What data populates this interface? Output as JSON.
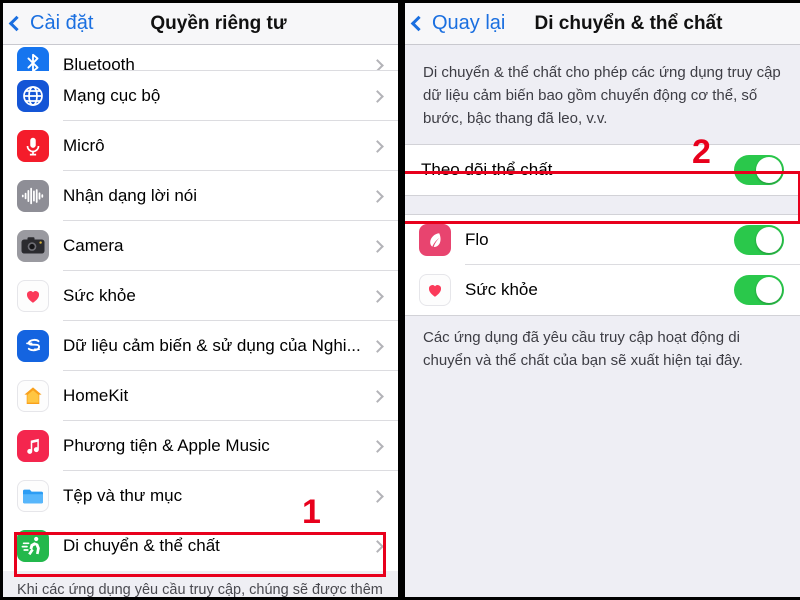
{
  "left": {
    "nav": {
      "back_label": "Cài đặt",
      "title": "Quyền riêng tư"
    },
    "rows": [
      {
        "label": "Bluetooth",
        "icon": "bluetooth-icon"
      },
      {
        "label": "Mạng cục bộ",
        "icon": "local-network-icon"
      },
      {
        "label": "Micrô",
        "icon": "microphone-icon"
      },
      {
        "label": "Nhận dạng lời nói",
        "icon": "speech-recognition-icon"
      },
      {
        "label": "Camera",
        "icon": "camera-icon"
      },
      {
        "label": "Sức khỏe",
        "icon": "health-icon"
      },
      {
        "label": "Dữ liệu cảm biến & sử dụng của Nghi...",
        "icon": "research-sensor-icon"
      },
      {
        "label": "HomeKit",
        "icon": "homekit-icon"
      },
      {
        "label": "Phương tiện & Apple Music",
        "icon": "apple-music-icon"
      },
      {
        "label": "Tệp và thư mục",
        "icon": "files-folder-icon"
      },
      {
        "label": "Di chuyển & thể chất",
        "icon": "motion-fitness-icon"
      }
    ],
    "footer_note": "Khi các ứng dụng yêu cầu truy cập, chúng sẽ được thêm"
  },
  "right": {
    "nav": {
      "back_label": "Quay lại",
      "title": "Di chuyển & thể chất"
    },
    "description": "Di chuyển & thể chất cho phép các ứng dụng truy cập dữ liệu cảm biến bao gồm chuyển động cơ thể, số bước, bậc thang đã leo, v.v.",
    "main_toggle": {
      "label": "Theo dõi thể chất",
      "state": "on"
    },
    "apps": [
      {
        "label": "Flo",
        "icon": "flo-app-icon",
        "state": "on"
      },
      {
        "label": "Sức khỏe",
        "icon": "health-app-icon",
        "state": "on"
      }
    ],
    "apps_note": "Các ứng dụng đã yêu cầu truy cập hoạt động di chuyển và thể chất của bạn sẽ xuất hiện tại đây."
  },
  "annotations": {
    "step1": "1",
    "step2": "2",
    "highlight_color": "#e8001c"
  }
}
